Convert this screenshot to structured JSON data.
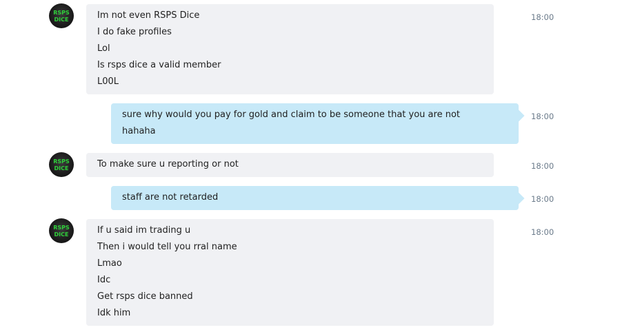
{
  "avatar": {
    "icon": "rsps-dice-logo-icon",
    "text": "RSPS DICE",
    "accent": "#2fcf3a"
  },
  "messages": [
    {
      "direction": "in",
      "time": "18:00",
      "lines": [
        "Im not even RSPS Dice",
        "I do fake profiles",
        "Lol",
        "Is rsps dice a valid member",
        "L00L"
      ]
    },
    {
      "direction": "out",
      "time": "18:00",
      "lines": [
        "sure why would you pay for gold and claim to be someone that you are not",
        "hahaha"
      ]
    },
    {
      "direction": "in",
      "time": "18:00",
      "lines": [
        "To make sure u reporting or not"
      ]
    },
    {
      "direction": "out",
      "time": "18:00",
      "lines": [
        "staff are not retarded"
      ]
    },
    {
      "direction": "in",
      "time": "18:00",
      "lines": [
        "If u said im trading u",
        "Then i would tell you rral name",
        "Lmao",
        "Idc",
        "Get rsps dice banned",
        "Idk him"
      ]
    }
  ],
  "colors": {
    "incoming_bubble": "#f0f1f4",
    "outgoing_bubble": "#c7e9f8",
    "timestamp": "#6a7a8a"
  }
}
